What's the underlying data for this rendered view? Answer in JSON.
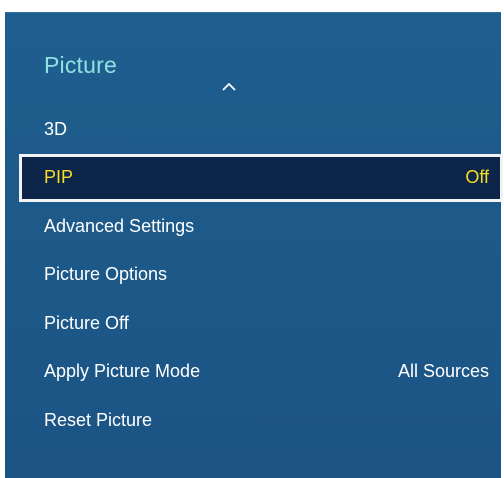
{
  "menu": {
    "title": "Picture",
    "scroll_up_icon": "chevron-up-icon",
    "colors": {
      "panel": "#1d5a8a",
      "title": "#8fe2e0",
      "text": "#ffffff",
      "selected_background": "#0c2548",
      "selected_text": "#f6dd2a",
      "selected_border": "#f3f3f3"
    },
    "items": [
      {
        "label": "3D",
        "value": ""
      },
      {
        "label": "PIP",
        "value": "Off",
        "selected": true
      },
      {
        "label": "Advanced Settings",
        "value": ""
      },
      {
        "label": "Picture Options",
        "value": ""
      },
      {
        "label": "Picture Off",
        "value": ""
      },
      {
        "label": "Apply Picture Mode",
        "value": "All Sources"
      },
      {
        "label": "Reset Picture",
        "value": ""
      }
    ]
  }
}
